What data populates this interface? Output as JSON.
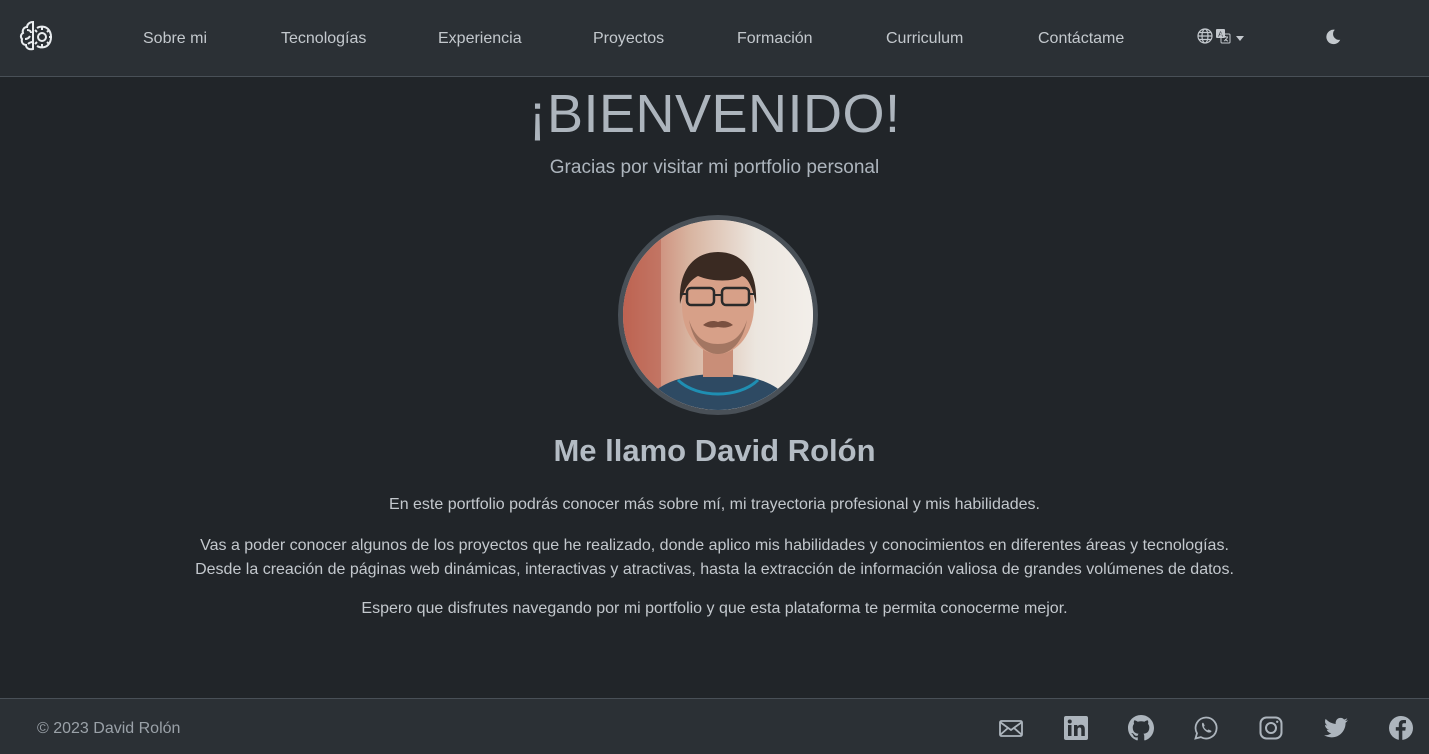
{
  "nav": {
    "items": [
      {
        "label": "Sobre mi"
      },
      {
        "label": "Tecnologías"
      },
      {
        "label": "Experiencia"
      },
      {
        "label": "Proyectos"
      },
      {
        "label": "Formación"
      },
      {
        "label": "Curriculum"
      },
      {
        "label": "Contáctame"
      }
    ],
    "language_icon": "globe-translate-icon",
    "theme_icon": "moon-icon"
  },
  "hero": {
    "title": "¡BIENVENIDO!",
    "subtitle": "Gracias por visitar mi portfolio personal"
  },
  "profile": {
    "name_heading": "Me llamo David Rolón",
    "intro": "En este portfolio podrás conocer más sobre mí, mi trayectoria profesional y mis habilidades.",
    "projects_line1": "Vas a poder conocer algunos de los proyectos que he realizado, donde aplico mis habilidades y conocimientos en diferentes áreas y tecnologías.",
    "projects_line2": "Desde la creación de páginas web dinámicas, interactivas y atractivas, hasta la extracción de información valiosa de grandes volúmenes de datos.",
    "closing": "Espero que disfrutes navegando por mi portfolio y que esta plataforma te permita conocerme mejor."
  },
  "footer": {
    "copyright": "© 2023 David Rolón",
    "social_icons": [
      "email-icon",
      "linkedin-icon",
      "github-icon",
      "whatsapp-icon",
      "instagram-icon",
      "twitter-icon",
      "facebook-icon"
    ]
  },
  "colors": {
    "background": "#212529",
    "navbar": "#2b3035",
    "text": "#c3c8cd",
    "muted": "#adb5bd"
  }
}
